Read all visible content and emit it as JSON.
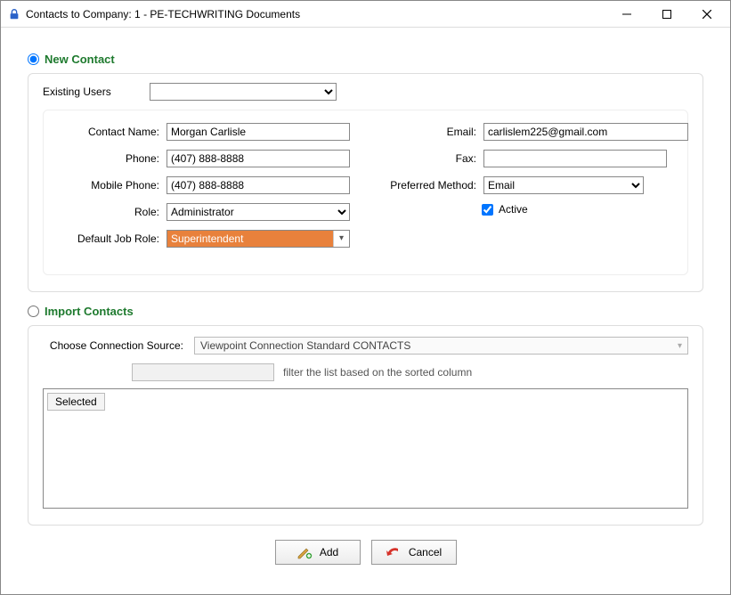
{
  "window": {
    "title": "Contacts to Company: 1 - PE-TECHWRITING Documents"
  },
  "sections": {
    "new_contact_label": "New Contact",
    "import_contacts_label": "Import Contacts"
  },
  "existing_users": {
    "label": "Existing Users",
    "value": ""
  },
  "fields": {
    "contact_name": {
      "label": "Contact Name:",
      "value": "Morgan Carlisle"
    },
    "phone": {
      "label": "Phone:",
      "value": "(407) 888-8888"
    },
    "mobile_phone": {
      "label": "Mobile Phone:",
      "value": "(407) 888-8888"
    },
    "role": {
      "label": "Role:",
      "value": "Administrator"
    },
    "default_job_role": {
      "label": "Default Job Role:",
      "value": "Superintendent"
    },
    "email": {
      "label": "Email:",
      "value": "carlislem225@gmail.com"
    },
    "fax": {
      "label": "Fax:",
      "value": ""
    },
    "preferred_method": {
      "label": "Preferred Method:",
      "value": "Email"
    },
    "active": {
      "label": "Active",
      "checked": true
    }
  },
  "import": {
    "choose_label": "Choose Connection Source:",
    "choose_value": "Viewpoint Connection Standard CONTACTS",
    "filter_value": "",
    "filter_hint": "filter the list based on the sorted column",
    "col_selected": "Selected"
  },
  "buttons": {
    "add": "Add",
    "cancel": "Cancel"
  }
}
